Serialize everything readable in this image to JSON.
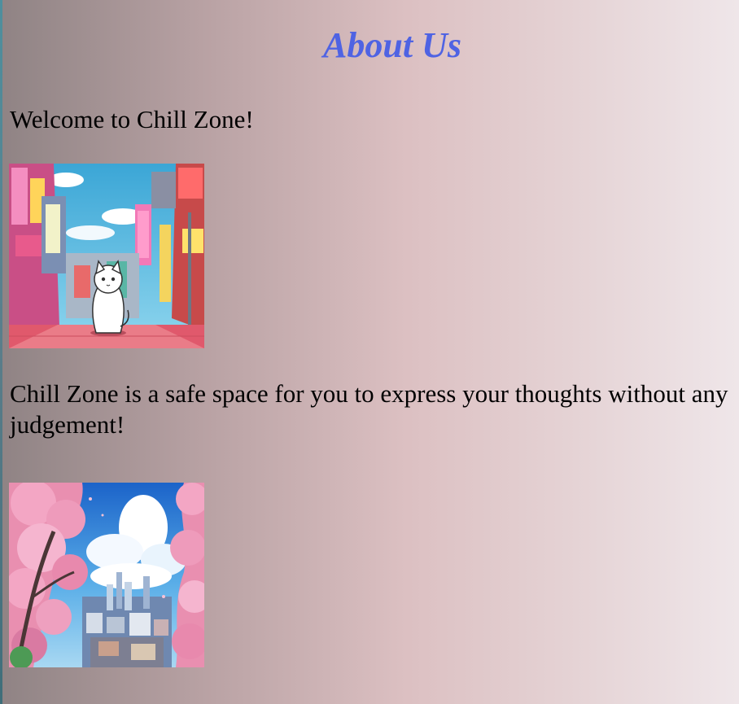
{
  "page": {
    "title": "About Us",
    "welcome": "Welcome to Chill Zone!",
    "description": "Chill Zone is a safe space for you to express your thoughts without any judgement!"
  },
  "images": {
    "street_cat": "anime-street-cat-image",
    "cherry_city": "cherry-blossom-city-image"
  },
  "colors": {
    "title": "#4f63e3",
    "background_left": "#8f8384",
    "background_right": "#efe6e9"
  }
}
